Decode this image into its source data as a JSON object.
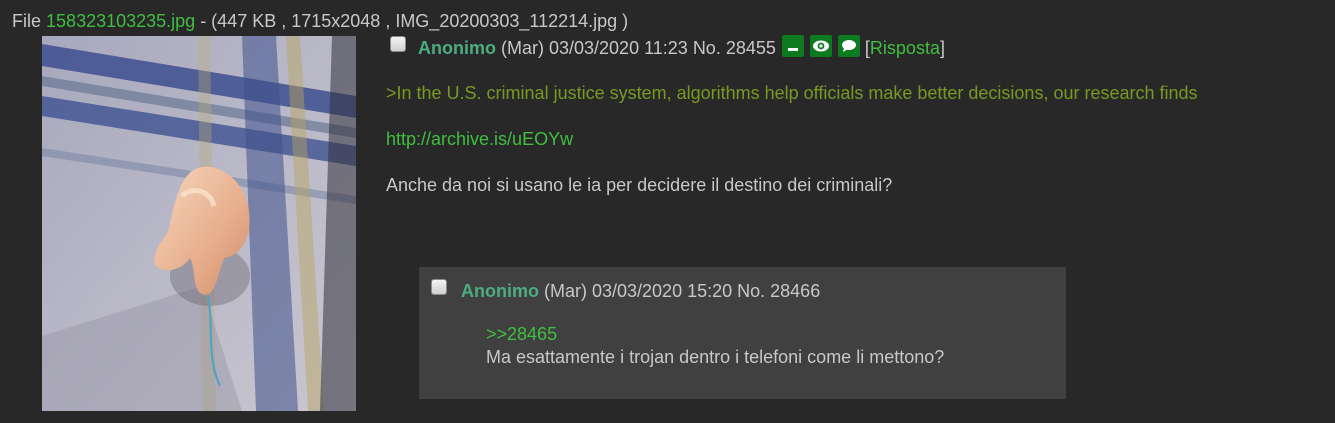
{
  "file": {
    "label": "File",
    "link_text": "158323103235.jpg",
    "meta": " - (447 KB , 1715x2048 , IMG_20200303_112214.jpg )"
  },
  "op": {
    "name": "Anonimo",
    "datetime": "(Mar) 03/03/2020 11:23",
    "number": "No. 28455",
    "reply_open": "[",
    "reply_label": "Risposta",
    "reply_close": "]",
    "greentext": ">In the U.S. criminal justice system, algorithms help officials make better decisions, our research finds",
    "link": "http://archive.is/uEOYw",
    "message": "Anche da noi si usano le ia per decidere il destino dei criminali?"
  },
  "reply": {
    "name": "Anonimo",
    "datetime": "(Mar) 03/03/2020 15:20",
    "number": "No. 28466",
    "quote": ">>28465",
    "message": "Ma esattamente i trojan dentro i telefoni come li mettono?"
  },
  "colors": {
    "background": "#282828",
    "reply_background": "#404040",
    "link": "#3fbf3f",
    "greentext": "#789922",
    "name": "#4cae7e",
    "icon_button": "#0c7a1e"
  },
  "icons": [
    "hide-icon",
    "watch-eye-icon",
    "speech-bubble-icon"
  ]
}
